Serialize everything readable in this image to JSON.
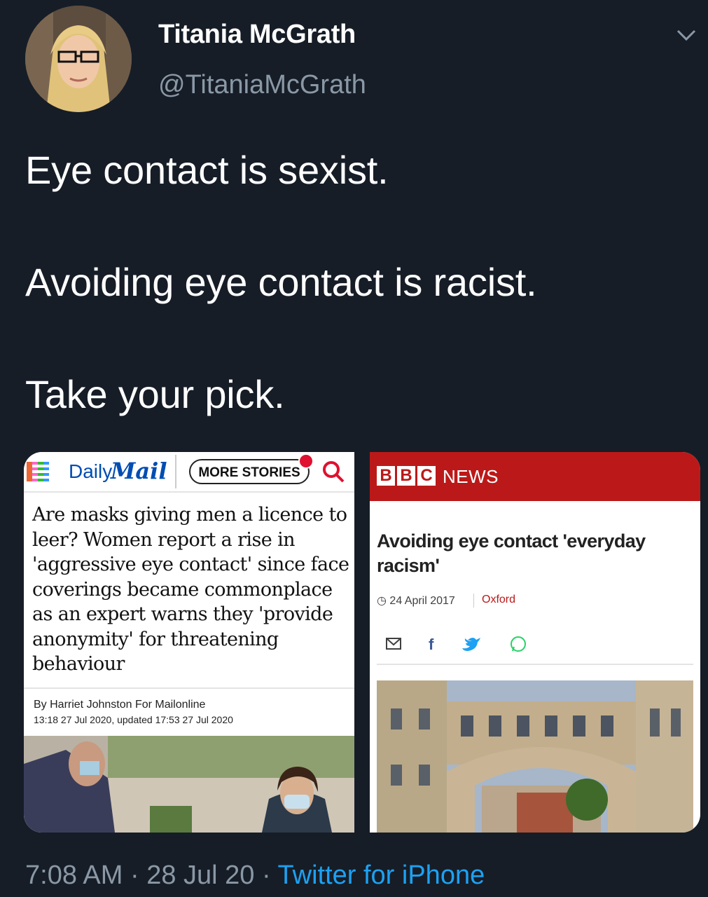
{
  "tweet": {
    "display_name": "Titania McGrath",
    "handle": "@TitaniaMcGrath",
    "lines": [
      "Eye contact is sexist.",
      "Avoiding eye contact is racist.",
      "Take your pick."
    ],
    "time": "7:08 AM",
    "date": "28 Jul 20",
    "separator": "·",
    "source": "Twitter for iPhone"
  },
  "daily_mail": {
    "logo_daily": "Daily",
    "logo_mail": "Mail",
    "more_stories": "MORE STORIES",
    "headline": "Are masks giving men a licence to leer? Women report a rise in 'aggressive eye contact' since face coverings became commonplace as an expert warns they 'provide anonymity' for threatening behaviour",
    "byline": "By Harriet Johnston For Mailonline",
    "timestamp": "13:18 27 Jul 2020, updated 17:53 27 Jul 2020"
  },
  "bbc": {
    "logo_letters": [
      "B",
      "B",
      "C"
    ],
    "news_label": "NEWS",
    "headline": "Avoiding eye contact 'everyday racism'",
    "date": "24 April 2017",
    "location": "Oxford",
    "share_icons": [
      "email-icon",
      "facebook-icon",
      "twitter-icon",
      "whatsapp-icon"
    ]
  },
  "colors": {
    "background": "#161d27",
    "handle_gray": "#8a98a6",
    "twitter_blue": "#1da1f2",
    "bbc_red": "#bb1919",
    "dm_blue": "#004db3"
  }
}
